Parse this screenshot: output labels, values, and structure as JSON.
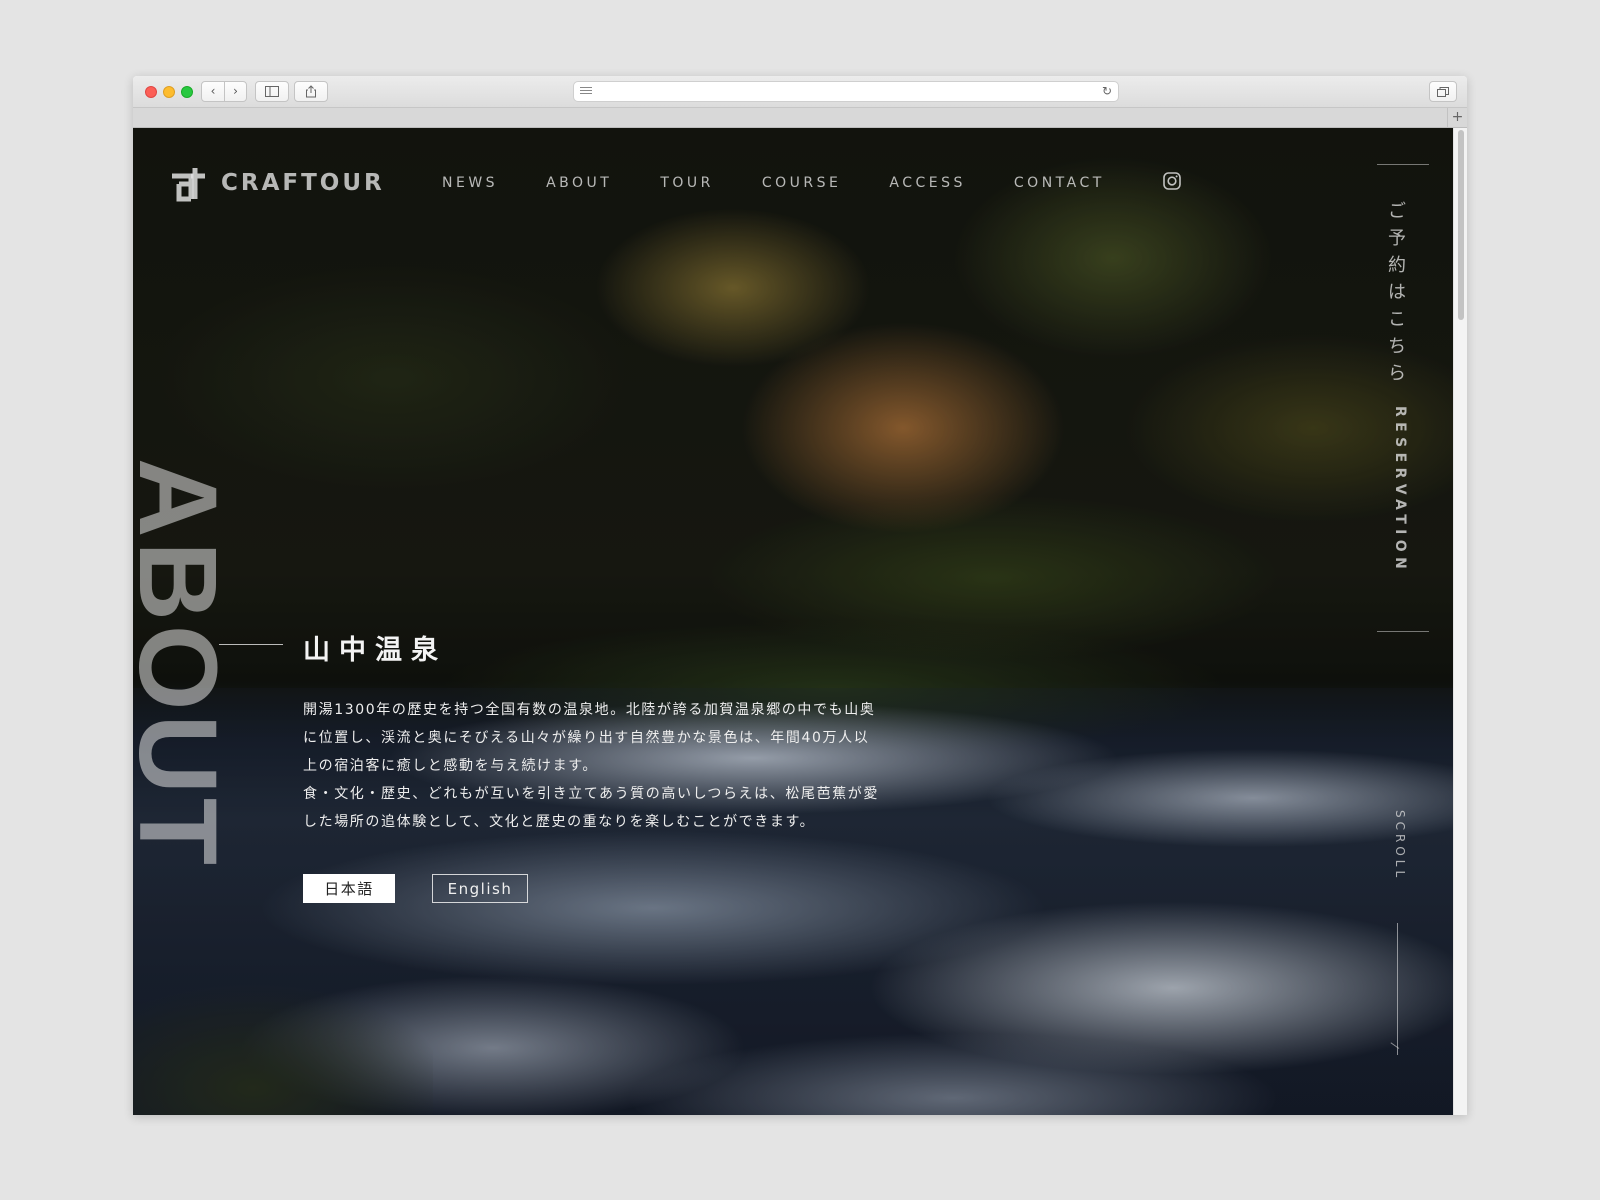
{
  "site": {
    "logo_text": "CRAFTOUR",
    "nav": [
      "NEWS",
      "ABOUT",
      "TOUR",
      "COURSE",
      "ACCESS",
      "CONTACT"
    ],
    "social_icon": "instagram-icon"
  },
  "sidebar_right": {
    "reserve_jp": [
      "ご",
      "予",
      "約",
      "は",
      "こ",
      "ち",
      "ら"
    ],
    "reserve_en": "RESERVATION",
    "scroll_label": "SCROLL"
  },
  "hero": {
    "bg_word": "ABOUT",
    "title": "山中温泉",
    "paragraphs": [
      "開湯1300年の歴史を持つ全国有数の温泉地。北陸が誇る加賀温泉郷の中でも山奥に位置し、渓流と奥にそびえる山々が繰り出す自然豊かな景色は、年間40万人以上の宿泊客に癒しと感動を与え続けます。",
      "食・文化・歴史、どれもが互いを引き立てあう質の高いしつらえは、松尾芭蕉が愛した場所の追体験として、文化と歴史の重なりを楽しむことができます。"
    ],
    "lang_buttons": {
      "japanese": "日本語",
      "english": "English"
    },
    "active_language": "日本語"
  },
  "browser": {
    "url_text": ""
  }
}
